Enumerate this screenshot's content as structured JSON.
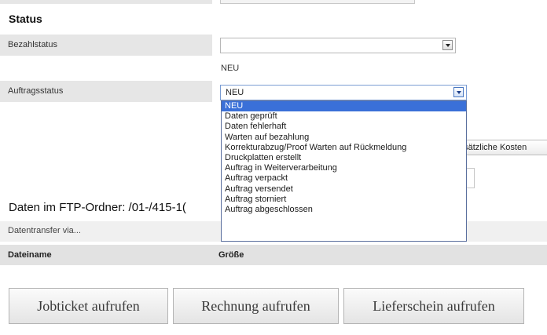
{
  "status": {
    "section_title": "Status",
    "payment_status_label": "Bezahlstatus",
    "payment_status_value": "",
    "current_status_text": "NEU",
    "order_status_label": "Auftragsstatus",
    "order_status_value": "NEU",
    "order_status_options": [
      "NEU",
      "Daten geprüft",
      "Daten fehlerhaft",
      "Warten auf bezahlung",
      "Korrekturabzug/Proof Warten auf Rückmeldung",
      "Druckplatten erstellt",
      "Auftrag in Weiterverarbeitung",
      "Auftrag verpackt",
      "Auftrag versendet",
      "Auftrag storniert",
      "Auftrag abgeschlossen"
    ],
    "extra_costs_button_partial": "usätzliche Kosten"
  },
  "ftp": {
    "heading": "Daten im FTP-Ordner: /01-/415-1(",
    "transfer_label": "Datentransfer via...",
    "col_filename": "Dateiname",
    "col_size": "Größe"
  },
  "actions": {
    "jobticket": "Jobticket aufrufen",
    "invoice": "Rechnung aufrufen",
    "delivery_note": "Lieferschein aufrufen"
  },
  "colors": {
    "selected_option_bg": "#3a70d8",
    "label_cell_bg": "#e6e6e6"
  }
}
